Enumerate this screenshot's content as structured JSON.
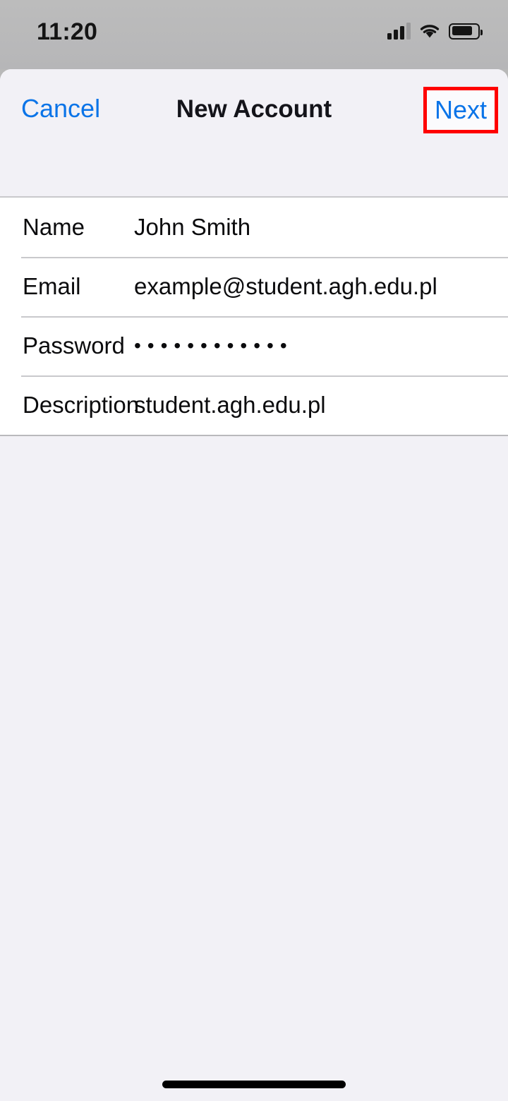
{
  "status_bar": {
    "time": "11:20",
    "cellular_icon": "cellular-signal-icon",
    "cellular_bars_filled": 3,
    "cellular_bars_total": 4,
    "wifi_icon": "wifi-icon",
    "battery_icon": "battery-icon",
    "battery_level_percent": 70
  },
  "nav_bar": {
    "cancel_label": "Cancel",
    "title": "New Account",
    "next_label": "Next",
    "highlight_color": "#ff0000",
    "tint_color": "#0a74e8"
  },
  "form": {
    "rows": [
      {
        "label": "Name",
        "value": "John Smith",
        "masked": false
      },
      {
        "label": "Email",
        "value": "example@student.agh.edu.pl",
        "masked": false
      },
      {
        "label": "Password",
        "value": "••••••••••••",
        "masked": true
      },
      {
        "label": "Description",
        "value": "student.agh.edu.pl",
        "masked": false
      }
    ]
  },
  "home_indicator": {
    "name": "home-indicator"
  }
}
